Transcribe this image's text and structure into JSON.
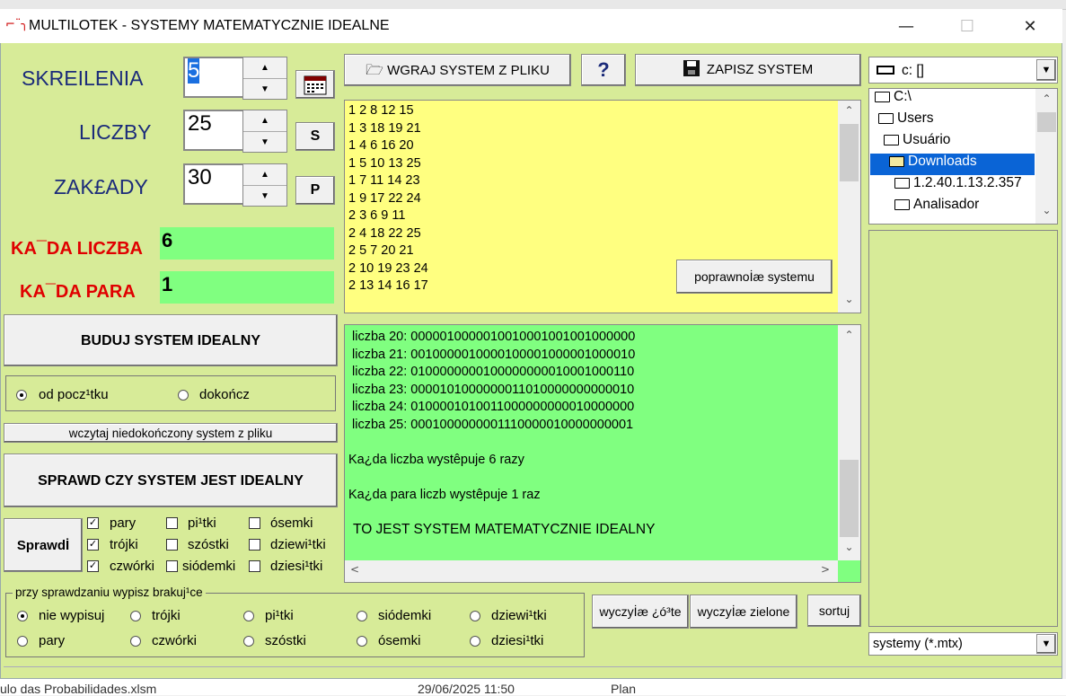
{
  "window": {
    "title": "MULTILOTEK - SYSTEMY MATEMATYCZNIE IDEALNE",
    "minimize": "—",
    "maximize": "☐",
    "close": "✕"
  },
  "left": {
    "skreslenia_label": "SKREILENIA",
    "skreslenia_value": "5",
    "liczby_label": "LICZBY",
    "liczby_value": "25",
    "zaklady_label": "ZAK£ADY",
    "zaklady_value": "30",
    "s_button": "S",
    "p_button": "P",
    "kazda_liczba_label": "KA¯DA LICZBA",
    "kazda_liczba_value": "6",
    "kazda_para_label": "KA¯DA PARA",
    "kazda_para_value": "1",
    "buduj_button": "BUDUJ SYSTEM IDEALNY",
    "od_poczatku": "od pocz¹tku",
    "dokoncz": "dokończ",
    "wczytaj_button": "wczytaj niedokończony  system z pliku",
    "sprawdz_button": "SPRAWD  CZY SYSTEM JEST IDEALNY",
    "sprawdz_small": "Sprawdİ",
    "checks": [
      {
        "label": "pary",
        "checked": true
      },
      {
        "label": "pi¹tki",
        "checked": false
      },
      {
        "label": "ósemki",
        "checked": false
      },
      {
        "label": "trójki",
        "checked": true
      },
      {
        "label": "szóstki",
        "checked": false
      },
      {
        "label": "dziewi¹tki",
        "checked": false
      },
      {
        "label": "czwórki",
        "checked": true
      },
      {
        "label": "siódemki",
        "checked": false
      },
      {
        "label": "dziesi¹tki",
        "checked": false
      }
    ],
    "missing_group_title": "przy sprawdzaniu wypisz brakuj¹ce",
    "missing": [
      {
        "label": "nie wypisuj",
        "on": true
      },
      {
        "label": "trójki",
        "on": false
      },
      {
        "label": "pi¹tki",
        "on": false
      },
      {
        "label": "siódemki",
        "on": false
      },
      {
        "label": "dziewi¹tki",
        "on": false
      },
      {
        "label": "pary",
        "on": false
      },
      {
        "label": "czwórki",
        "on": false
      },
      {
        "label": "szóstki",
        "on": false
      },
      {
        "label": "ósemki",
        "on": false
      },
      {
        "label": "dziesi¹tki",
        "on": false
      }
    ]
  },
  "toolbar": {
    "load_button": "WGRAJ SYSTEM Z PLIKU",
    "help_button": "?",
    "save_button": "ZAPISZ SYSTEM"
  },
  "system_lines": [
    "1 2 8 12 15",
    "1 3 18 19 21",
    "1 4 6 16 20",
    "1 5 10 13 25",
    "1 7 11 14 23",
    "1 9 17 22 24",
    "2 3 6 9 11",
    "2 4 18 22 25",
    "2 5 7 20 21",
    "2 10 19 23 24",
    "2 13 14 16 17"
  ],
  "poprawnosc_button": "poprawnoİæ systemu",
  "result_lines": [
    "liczba 20: 0000010000010010001001001000000",
    "liczba 21: 0010000010000100001000001000010",
    "liczba 22: 0100000000100000000010001000110",
    "liczba 23: 0000101000000011010000000000010",
    "liczba 24: 0100001010011000000000010000000",
    "liczba 25: 0001000000001110000010000000001"
  ],
  "result_kazda_liczba": "Ka¿da liczba wystêpuje 6 razy",
  "result_kazda_para": "Ka¿da para liczb wystêpuje 1 raz",
  "result_verdict": "TO JEST SYSTEM MATEMATYCZNIE IDEALNY",
  "bottom_buttons": {
    "clear_yellow": "wyczyİæ ¿ó³te",
    "clear_green": "wyczyİæ zielone",
    "sort": "sortuj"
  },
  "drive": "c: []",
  "tree": [
    "C:\\",
    "Users",
    "Usuário",
    "Downloads",
    "1.2.40.1.13.2.357",
    "Analisador"
  ],
  "filter": "systemy (*.mtx)",
  "background_taskbar": {
    "file": "ulo das Probabilidades.xlsm",
    "date": "29/06/2025 11:50",
    "type": "Plan"
  }
}
